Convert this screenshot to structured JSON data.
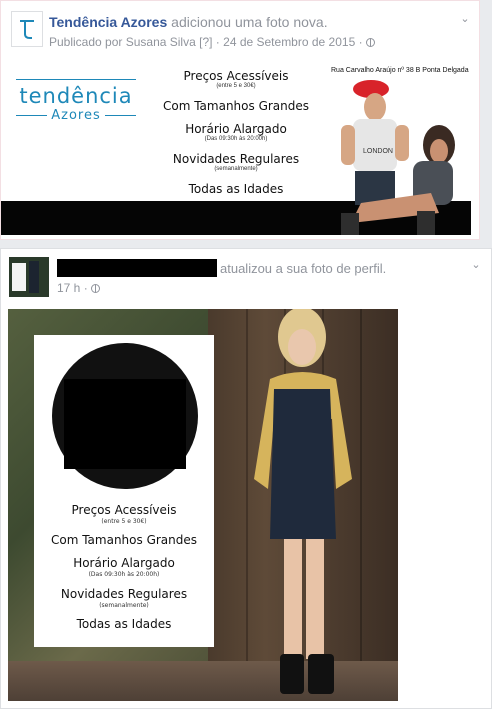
{
  "post1": {
    "page_name": "Tendência Azores",
    "action": "adicionou uma foto nova.",
    "published_by": "Publicado por Susana Silva",
    "help": "[?]",
    "date": "24 de Setembro de 2015",
    "separator": "·",
    "banner": {
      "brand_line1": "tendência",
      "brand_line2": "Azores",
      "address": "Rua Carvalho Araújo nº 38 B Ponta Delgada",
      "lines": [
        {
          "text": "Preços Acessíveis",
          "sub": "(entre 5 e 30€)"
        },
        {
          "text": "Com Tamanhos Grandes",
          "sub": ""
        },
        {
          "text": "Horário Alargado",
          "sub": "(Das 09:30h às 20:00h)"
        },
        {
          "text": "Novidades Regulares",
          "sub": "(semanalmente)"
        },
        {
          "text": "Todas as Idades",
          "sub": ""
        }
      ],
      "shirt_text": "LONDON"
    }
  },
  "post2": {
    "action": "atualizou a sua foto de perfil.",
    "time": "17 h",
    "separator": "·",
    "poster": {
      "lines": [
        {
          "text": "Preços Acessíveis",
          "sub": "(entre 5 e 30€)"
        },
        {
          "text": "Com Tamanhos Grandes",
          "sub": ""
        },
        {
          "text": "Horário Alargado",
          "sub": "(Das 09:30h às 20:00h)"
        },
        {
          "text": "Novidades Regulares",
          "sub": "(semanalmente)"
        },
        {
          "text": "Todas as Idades",
          "sub": ""
        }
      ]
    }
  },
  "icons": {
    "chevron": "chevron-down-icon",
    "globe": "globe-icon",
    "logo": "tendencia-logo-icon"
  },
  "colors": {
    "link": "#365899",
    "meta": "#90949c",
    "brand": "#1e88b8"
  }
}
